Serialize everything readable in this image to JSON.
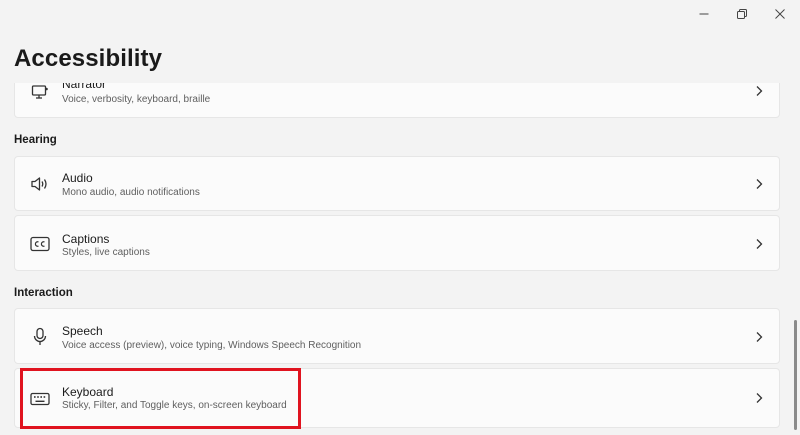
{
  "page": {
    "title": "Accessibility"
  },
  "window_controls": {
    "icons": [
      "minimize-icon",
      "restore-icon",
      "close-icon"
    ]
  },
  "items": {
    "narrator": {
      "title": "Narrator",
      "subtitle": "Voice, verbosity, keyboard, braille",
      "icon": "narrator-icon"
    },
    "audio": {
      "title": "Audio",
      "subtitle": "Mono audio, audio notifications",
      "icon": "speaker-icon"
    },
    "captions": {
      "title": "Captions",
      "subtitle": "Styles, live captions",
      "icon": "closed-captions-icon"
    },
    "speech": {
      "title": "Speech",
      "subtitle": "Voice access (preview), voice typing, Windows Speech Recognition",
      "icon": "microphone-icon"
    },
    "keyboard": {
      "title": "Keyboard",
      "subtitle": "Sticky, Filter, and Toggle keys, on-screen keyboard",
      "icon": "keyboard-icon"
    }
  },
  "sections": {
    "hearing": "Hearing",
    "interaction": "Interaction"
  },
  "colors": {
    "background": "#f3f3f3",
    "card": "#fbfbfb",
    "highlight": "#e0131f"
  }
}
